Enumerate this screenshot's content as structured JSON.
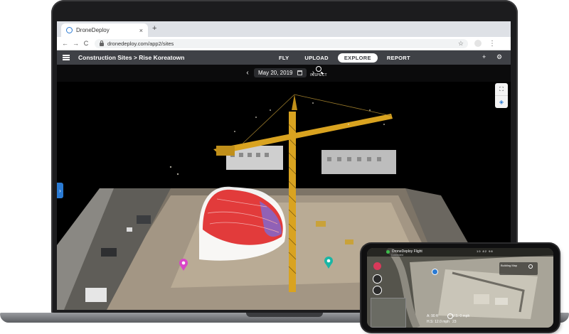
{
  "browser": {
    "tab_title": "DroneDeploy",
    "tab_close": "×",
    "new_tab": "+",
    "url": "dronedeploy.com/app2/sites",
    "nav_back": "←",
    "nav_forward": "→",
    "nav_reload": "C",
    "bookmark_icon": "☆",
    "menu_icon": "⋮"
  },
  "app": {
    "breadcrumb": "Construction Sites > Rise Koreatown",
    "tabs": [
      {
        "label": "FLY",
        "active": false
      },
      {
        "label": "UPLOAD",
        "active": false
      },
      {
        "label": "EXPLORE",
        "active": true
      },
      {
        "label": "REPORT",
        "active": false
      }
    ],
    "add_user_icon": "+",
    "settings_icon": "⚙"
  },
  "datebar": {
    "prev": "‹",
    "date": "May 20, 2019",
    "next": "›",
    "inspect_label": "INSPECT"
  },
  "viewport": {
    "side_tab": "›",
    "tools": [
      {
        "icon": "fit-view-icon",
        "glyph": "⛶"
      },
      {
        "icon": "layers-icon",
        "glyph": "◈"
      }
    ]
  },
  "phone": {
    "status": "DroneDeploy Flight",
    "sub": "Connected",
    "stats": "10 82 98",
    "flight_plan": "Building Map",
    "telemetry": "A: 90 ft\nH.S: 12.0 mph",
    "speed": "V.S: 0 mph\n23"
  },
  "colors": {
    "accent": "#2a7ad3",
    "header": "#3f4146",
    "pin_magenta": "#d946c8",
    "pin_teal": "#19b6a5",
    "pin_yellow": "#f2b600"
  }
}
